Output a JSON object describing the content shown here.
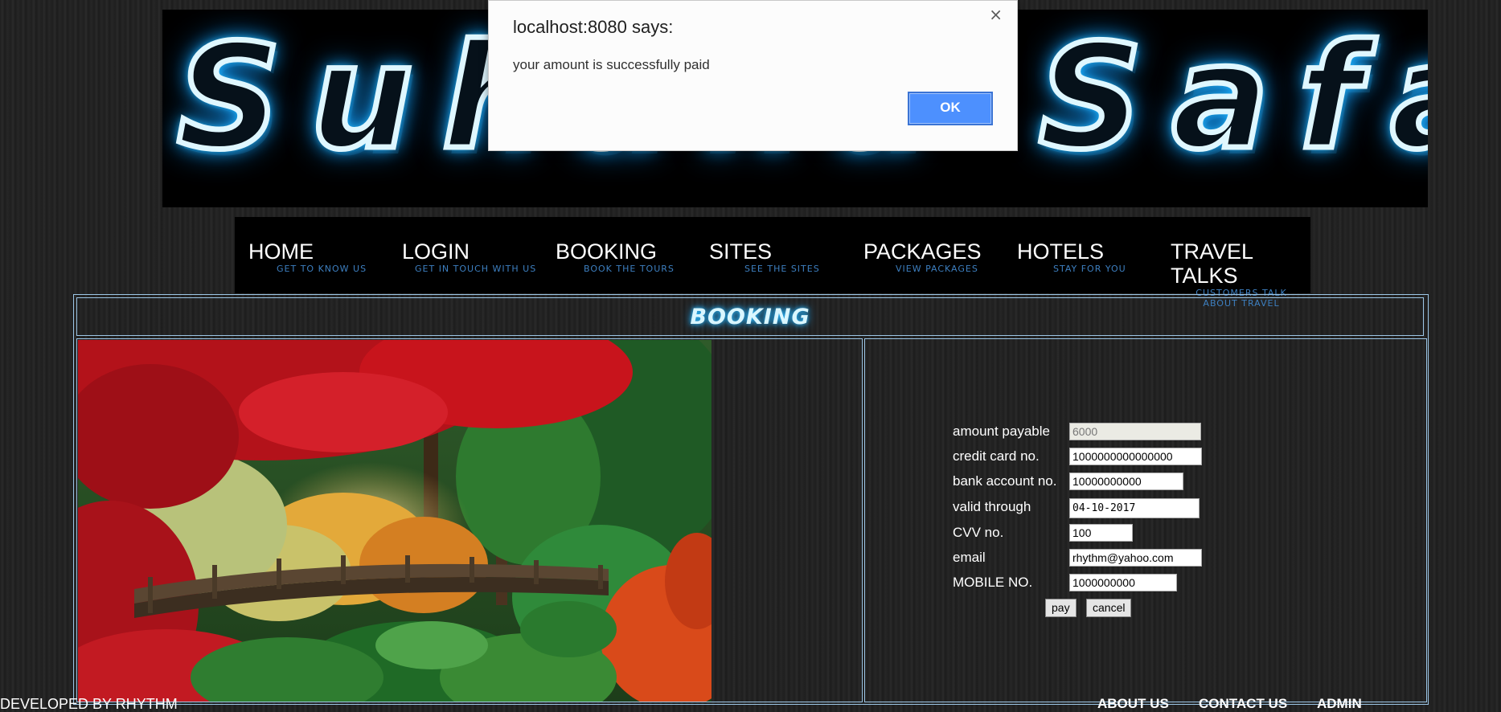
{
  "banner": {
    "title": "Suhana Safar"
  },
  "nav": {
    "items": [
      {
        "label": "HOME",
        "sub": "GET TO KNOW US"
      },
      {
        "label": "LOGIN",
        "sub": "GET IN TOUCH WITH US"
      },
      {
        "label": "BOOKING",
        "sub": "BOOK THE TOURS"
      },
      {
        "label": "SITES",
        "sub": "SEE THE SITES"
      },
      {
        "label": "PACKAGES",
        "sub": "VIEW PACKAGES"
      },
      {
        "label": "HOTELS",
        "sub": "STAY FOR YOU"
      },
      {
        "label": "TRAVEL TALKS",
        "sub": "CUSTOMERS TALK ABOUT TRAVEL"
      }
    ]
  },
  "section": {
    "title": "BOOKING"
  },
  "form": {
    "amount_label": "amount payable",
    "amount_value": "6000",
    "card_label": "credit card no.",
    "card_value": "1000000000000000",
    "account_label": "bank account no.",
    "account_value": "10000000000",
    "valid_label": "valid through",
    "valid_value": "04-10-2017",
    "cvv_label": "CVV no.",
    "cvv_value": "100",
    "email_label": "email",
    "email_value": "rhythm@yahoo.com",
    "mobile_label": "MOBILE NO.",
    "mobile_value": "1000000000",
    "pay_label": "pay",
    "cancel_label": "cancel"
  },
  "footer": {
    "credit": "DEVELOPED BY RHYTHM",
    "about": "ABOUT US",
    "contact": "CONTACT US",
    "admin": "ADMIN"
  },
  "dialog": {
    "title": "localhost:8080 says:",
    "message": "your amount is successfully paid",
    "ok_label": "OK",
    "close_glyph": "×"
  },
  "colors": {
    "ok_button": "#4d90fe",
    "nav_sub": "#3d7fc0",
    "frame_border": "#9cc6e6",
    "neon": "#29c6ff"
  }
}
